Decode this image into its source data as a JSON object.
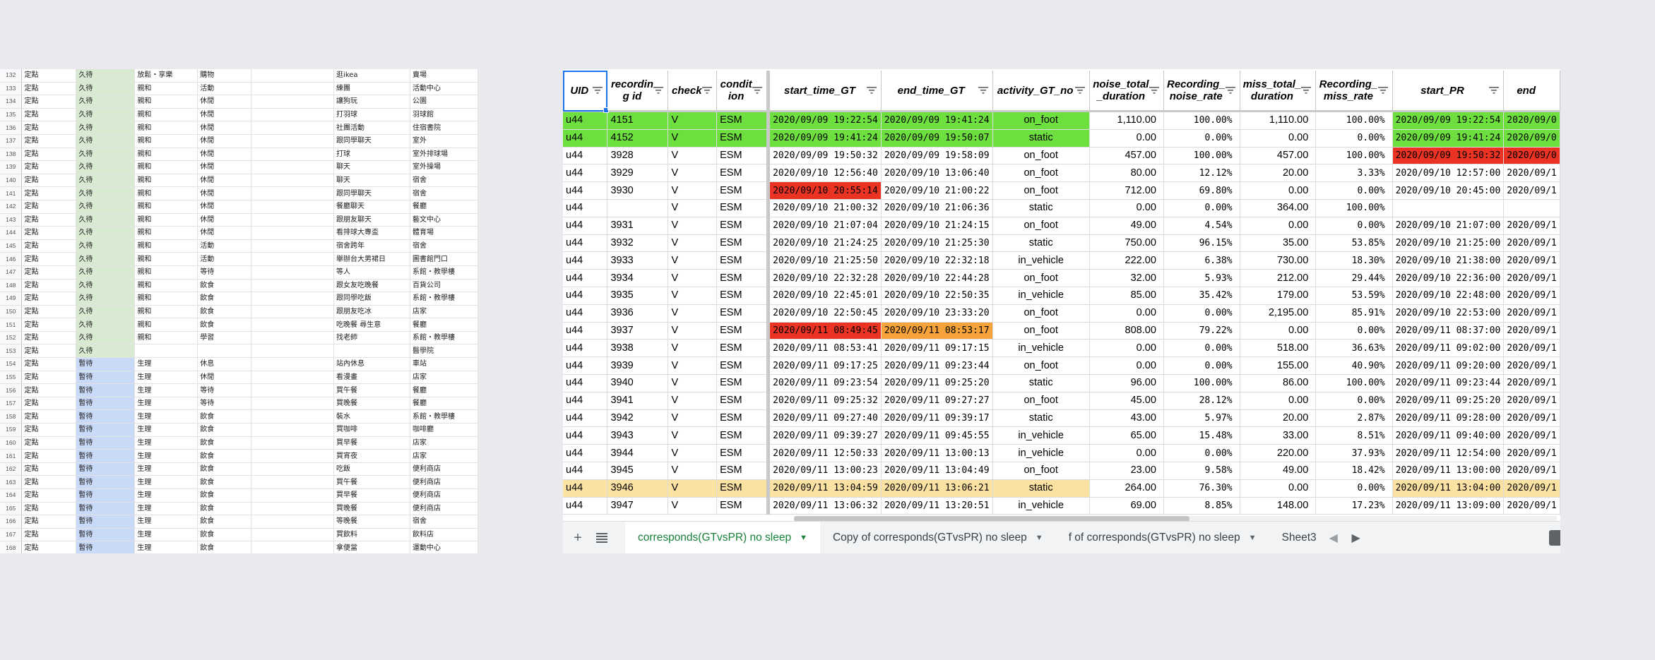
{
  "left_sheet": {
    "rows": [
      [
        "132",
        "定點",
        "久待",
        "放鬆・享樂",
        "購物",
        "",
        "逛ikea",
        "賣場"
      ],
      [
        "133",
        "定點",
        "久待",
        "親和",
        "活動",
        "",
        "練團",
        "活動中心"
      ],
      [
        "134",
        "定點",
        "久待",
        "親和",
        "休閒",
        "",
        "讓狗玩",
        "公園"
      ],
      [
        "135",
        "定點",
        "久待",
        "親和",
        "休閒",
        "",
        "打羽球",
        "羽球館"
      ],
      [
        "136",
        "定點",
        "久待",
        "親和",
        "休閒",
        "",
        "社團活動",
        "住宿書院"
      ],
      [
        "137",
        "定點",
        "久待",
        "親和",
        "休閒",
        "",
        "跟同學聊天",
        "室外"
      ],
      [
        "138",
        "定點",
        "久待",
        "親和",
        "休閒",
        "",
        "打球",
        "室外排球場"
      ],
      [
        "139",
        "定點",
        "久待",
        "親和",
        "休閒",
        "",
        "聊天",
        "室外操場"
      ],
      [
        "140",
        "定點",
        "久待",
        "親和",
        "休閒",
        "",
        "聊天",
        "宿舍"
      ],
      [
        "141",
        "定點",
        "久待",
        "親和",
        "休閒",
        "",
        "跟同學聊天",
        "宿舍"
      ],
      [
        "142",
        "定點",
        "久待",
        "親和",
        "休閒",
        "",
        "餐廳聊天",
        "餐廳"
      ],
      [
        "143",
        "定點",
        "久待",
        "親和",
        "休閒",
        "",
        "跟朋友聊天",
        "藝文中心"
      ],
      [
        "144",
        "定點",
        "久待",
        "親和",
        "休閒",
        "",
        "看排球大專盃",
        "體育場"
      ],
      [
        "145",
        "定點",
        "久待",
        "親和",
        "活動",
        "",
        "宿舍跨年",
        "宿舍"
      ],
      [
        "146",
        "定點",
        "久待",
        "親和",
        "活動",
        "",
        "舉辦台大男裙日",
        "圖書館門口"
      ],
      [
        "147",
        "定點",
        "久待",
        "親和",
        "等待",
        "",
        "等人",
        "系館・教學樓"
      ],
      [
        "148",
        "定點",
        "久待",
        "親和",
        "飲食",
        "",
        "跟女友吃晚餐",
        "百貨公司"
      ],
      [
        "149",
        "定點",
        "久待",
        "親和",
        "飲食",
        "",
        "跟同學吃飯",
        "系館・教學樓"
      ],
      [
        "150",
        "定點",
        "久待",
        "親和",
        "飲食",
        "",
        "跟朋友吃冰",
        "店家"
      ],
      [
        "151",
        "定點",
        "久待",
        "親和",
        "飲食",
        "",
        "吃晚餐 尋生意",
        "餐廳"
      ],
      [
        "152",
        "定點",
        "久待",
        "親和",
        "學習",
        "",
        "找老師",
        "系館・教學樓"
      ],
      [
        "153",
        "定點",
        "久待",
        "",
        "",
        "",
        "",
        "醫學院"
      ],
      [
        "154",
        "定點",
        "暫待",
        "生理",
        "休息",
        "",
        "站內休息",
        "車站"
      ],
      [
        "155",
        "定點",
        "暫待",
        "生理",
        "休閒",
        "",
        "看漫畫",
        "店家"
      ],
      [
        "156",
        "定點",
        "暫待",
        "生理",
        "等待",
        "",
        "買午餐",
        "餐廳"
      ],
      [
        "157",
        "定點",
        "暫待",
        "生理",
        "等待",
        "",
        "買晚餐",
        "餐廳"
      ],
      [
        "158",
        "定點",
        "暫待",
        "生理",
        "飲食",
        "",
        "裝水",
        "系館・教學樓"
      ],
      [
        "159",
        "定點",
        "暫待",
        "生理",
        "飲食",
        "",
        "買咖啡",
        "咖啡廳"
      ],
      [
        "160",
        "定點",
        "暫待",
        "生理",
        "飲食",
        "",
        "買早餐",
        "店家"
      ],
      [
        "161",
        "定點",
        "暫待",
        "生理",
        "飲食",
        "",
        "買宵夜",
        "店家"
      ],
      [
        "162",
        "定點",
        "暫待",
        "生理",
        "飲食",
        "",
        "吃飯",
        "便利商店"
      ],
      [
        "163",
        "定點",
        "暫待",
        "生理",
        "飲食",
        "",
        "買午餐",
        "便利商店"
      ],
      [
        "164",
        "定點",
        "暫待",
        "生理",
        "飲食",
        "",
        "買早餐",
        "便利商店"
      ],
      [
        "165",
        "定點",
        "暫待",
        "生理",
        "飲食",
        "",
        "買晚餐",
        "便利商店"
      ],
      [
        "166",
        "定點",
        "暫待",
        "生理",
        "飲食",
        "",
        "等晚餐",
        "宿舍"
      ],
      [
        "167",
        "定點",
        "暫待",
        "生理",
        "飲食",
        "",
        "買飲料",
        "飲料店"
      ],
      [
        "168",
        "定點",
        "暫待",
        "生理",
        "飲食",
        "",
        "拿便當",
        "運動中心"
      ]
    ]
  },
  "headers": [
    {
      "key": "uid",
      "label": "UID"
    },
    {
      "key": "rid",
      "label": "recordin\ng id"
    },
    {
      "key": "check",
      "label": "check"
    },
    {
      "key": "cond",
      "label": "condit\nion"
    },
    {
      "key": "start_gt",
      "label": "start_time_GT"
    },
    {
      "key": "end_gt",
      "label": "end_time_GT"
    },
    {
      "key": "act",
      "label": "activity_GT_no"
    },
    {
      "key": "noise_total",
      "label": "noise_total\n_duration"
    },
    {
      "key": "rec_noise",
      "label": "Recording_\nnoise_rate"
    },
    {
      "key": "miss_total",
      "label": "miss_total_\nduration"
    },
    {
      "key": "rec_miss",
      "label": "Recording_\nmiss_rate"
    },
    {
      "key": "start_pr",
      "label": "start_PR"
    },
    {
      "key": "end_pr",
      "label": "end"
    }
  ],
  "rows": [
    {
      "cells": [
        "u44",
        "4151",
        "V",
        "ESM",
        "2020/09/09 19:22:54",
        "2020/09/09 19:41:24",
        "on_foot",
        "1,110.00",
        "100.00%",
        "1,110.00",
        "100.00%",
        "2020/09/09 19:22:54",
        "2020/09/0"
      ]
    },
    {
      "cells": [
        "u44",
        "4152",
        "V",
        "ESM",
        "2020/09/09 19:41:24",
        "2020/09/09 19:50:07",
        "static",
        "0.00",
        "0.00%",
        "0.00",
        "0.00%",
        "2020/09/09 19:41:24",
        "2020/09/0"
      ]
    },
    {
      "cells": [
        "u44",
        "3928",
        "V",
        "ESM",
        "2020/09/09 19:50:32",
        "2020/09/09 19:58:09",
        "on_foot",
        "457.00",
        "100.00%",
        "457.00",
        "100.00%",
        "2020/09/09 19:50:32",
        "2020/09/0"
      ]
    },
    {
      "cells": [
        "u44",
        "3929",
        "V",
        "ESM",
        "2020/09/10 12:56:40",
        "2020/09/10 13:06:40",
        "on_foot",
        "80.00",
        "12.12%",
        "20.00",
        "3.33%",
        "2020/09/10 12:57:00",
        "2020/09/1"
      ]
    },
    {
      "cells": [
        "u44",
        "3930",
        "V",
        "ESM",
        "2020/09/10 20:55:14",
        "2020/09/10 21:00:22",
        "on_foot",
        "712.00",
        "69.80%",
        "0.00",
        "0.00%",
        "2020/09/10 20:45:00",
        "2020/09/1"
      ]
    },
    {
      "cells": [
        "u44",
        "",
        "V",
        "ESM",
        "2020/09/10 21:00:32",
        "2020/09/10 21:06:36",
        "static",
        "0.00",
        "0.00%",
        "364.00",
        "100.00%",
        "",
        ""
      ]
    },
    {
      "cells": [
        "u44",
        "3931",
        "V",
        "ESM",
        "2020/09/10 21:07:04",
        "2020/09/10 21:24:15",
        "on_foot",
        "49.00",
        "4.54%",
        "0.00",
        "0.00%",
        "2020/09/10 21:07:00",
        "2020/09/1"
      ]
    },
    {
      "cells": [
        "u44",
        "3932",
        "V",
        "ESM",
        "2020/09/10 21:24:25",
        "2020/09/10 21:25:30",
        "static",
        "750.00",
        "96.15%",
        "35.00",
        "53.85%",
        "2020/09/10 21:25:00",
        "2020/09/1"
      ]
    },
    {
      "cells": [
        "u44",
        "3933",
        "V",
        "ESM",
        "2020/09/10 21:25:50",
        "2020/09/10 22:32:18",
        "in_vehicle",
        "222.00",
        "6.38%",
        "730.00",
        "18.30%",
        "2020/09/10 21:38:00",
        "2020/09/1"
      ]
    },
    {
      "cells": [
        "u44",
        "3934",
        "V",
        "ESM",
        "2020/09/10 22:32:28",
        "2020/09/10 22:44:28",
        "on_foot",
        "32.00",
        "5.93%",
        "212.00",
        "29.44%",
        "2020/09/10 22:36:00",
        "2020/09/1"
      ]
    },
    {
      "cells": [
        "u44",
        "3935",
        "V",
        "ESM",
        "2020/09/10 22:45:01",
        "2020/09/10 22:50:35",
        "in_vehicle",
        "85.00",
        "35.42%",
        "179.00",
        "53.59%",
        "2020/09/10 22:48:00",
        "2020/09/1"
      ]
    },
    {
      "cells": [
        "u44",
        "3936",
        "V",
        "ESM",
        "2020/09/10 22:50:45",
        "2020/09/10 23:33:20",
        "on_foot",
        "0.00",
        "0.00%",
        "2,195.00",
        "85.91%",
        "2020/09/10 22:53:00",
        "2020/09/1"
      ]
    },
    {
      "cells": [
        "u44",
        "3937",
        "V",
        "ESM",
        "2020/09/11 08:49:45",
        "2020/09/11 08:53:17",
        "on_foot",
        "808.00",
        "79.22%",
        "0.00",
        "0.00%",
        "2020/09/11 08:37:00",
        "2020/09/1"
      ]
    },
    {
      "cells": [
        "u44",
        "3938",
        "V",
        "ESM",
        "2020/09/11 08:53:41",
        "2020/09/11 09:17:15",
        "in_vehicle",
        "0.00",
        "0.00%",
        "518.00",
        "36.63%",
        "2020/09/11 09:02:00",
        "2020/09/1"
      ]
    },
    {
      "cells": [
        "u44",
        "3939",
        "V",
        "ESM",
        "2020/09/11 09:17:25",
        "2020/09/11 09:23:44",
        "on_foot",
        "0.00",
        "0.00%",
        "155.00",
        "40.90%",
        "2020/09/11 09:20:00",
        "2020/09/1"
      ]
    },
    {
      "cells": [
        "u44",
        "3940",
        "V",
        "ESM",
        "2020/09/11 09:23:54",
        "2020/09/11 09:25:20",
        "static",
        "96.00",
        "100.00%",
        "86.00",
        "100.00%",
        "2020/09/11 09:23:44",
        "2020/09/1"
      ]
    },
    {
      "cells": [
        "u44",
        "3941",
        "V",
        "ESM",
        "2020/09/11 09:25:32",
        "2020/09/11 09:27:27",
        "on_foot",
        "45.00",
        "28.12%",
        "0.00",
        "0.00%",
        "2020/09/11 09:25:20",
        "2020/09/1"
      ]
    },
    {
      "cells": [
        "u44",
        "3942",
        "V",
        "ESM",
        "2020/09/11 09:27:40",
        "2020/09/11 09:39:17",
        "static",
        "43.00",
        "5.97%",
        "20.00",
        "2.87%",
        "2020/09/11 09:28:00",
        "2020/09/1"
      ]
    },
    {
      "cells": [
        "u44",
        "3943",
        "V",
        "ESM",
        "2020/09/11 09:39:27",
        "2020/09/11 09:45:55",
        "in_vehicle",
        "65.00",
        "15.48%",
        "33.00",
        "8.51%",
        "2020/09/11 09:40:00",
        "2020/09/1"
      ]
    },
    {
      "cells": [
        "u44",
        "3944",
        "V",
        "ESM",
        "2020/09/11 12:50:33",
        "2020/09/11 13:00:13",
        "in_vehicle",
        "0.00",
        "0.00%",
        "220.00",
        "37.93%",
        "2020/09/11 12:54:00",
        "2020/09/1"
      ]
    },
    {
      "cells": [
        "u44",
        "3945",
        "V",
        "ESM",
        "2020/09/11 13:00:23",
        "2020/09/11 13:04:49",
        "on_foot",
        "23.00",
        "9.58%",
        "49.00",
        "18.42%",
        "2020/09/11 13:00:00",
        "2020/09/1"
      ]
    },
    {
      "cells": [
        "u44",
        "3946",
        "V",
        "ESM",
        "2020/09/11 13:04:59",
        "2020/09/11 13:06:21",
        "static",
        "264.00",
        "76.30%",
        "0.00",
        "0.00%",
        "2020/09/11 13:04:00",
        "2020/09/1"
      ]
    },
    {
      "cells": [
        "u44",
        "3947",
        "V",
        "ESM",
        "2020/09/11 13:06:32",
        "2020/09/11 13:20:51",
        "in_vehicle",
        "69.00",
        "8.85%",
        "148.00",
        "17.23%",
        "2020/09/11 13:09:00",
        "2020/09/1"
      ]
    }
  ],
  "highlights": {
    "green": "#6ddf3f",
    "red": "#ea3323",
    "orange": "#f5a33a",
    "yellow": "#fbe2a3"
  },
  "sheet_tabs": [
    {
      "label": "corresponds(GTvsPR) no sleep",
      "active": true
    },
    {
      "label": "Copy of corresponds(GTvsPR) no sleep",
      "active": false
    },
    {
      "label": "f of corresponds(GTvsPR) no sleep",
      "active": false
    },
    {
      "label": "Sheet3",
      "active": false
    }
  ],
  "icons": {
    "add_sheet": "plus-icon",
    "all_sheets": "list-icon",
    "filter": "filter-icon",
    "explore": "explore-icon"
  }
}
